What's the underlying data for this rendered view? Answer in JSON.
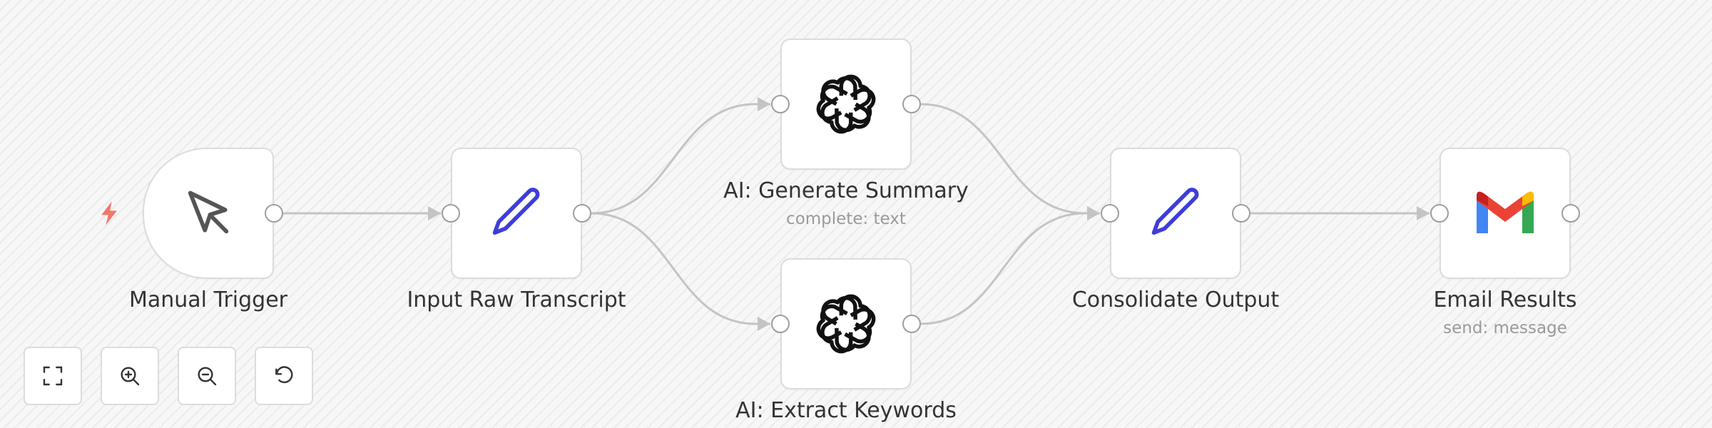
{
  "workflow": {
    "nodes": [
      {
        "id": "manual-trigger",
        "label": "Manual Trigger",
        "subtitle": "",
        "icon": "cursor-icon",
        "is_trigger": true
      },
      {
        "id": "input-raw-transcript",
        "label": "Input Raw Transcript",
        "subtitle": "",
        "icon": "pencil-icon"
      },
      {
        "id": "ai-generate-summary",
        "label": "AI: Generate Summary",
        "subtitle": "complete: text",
        "icon": "openai-icon"
      },
      {
        "id": "ai-extract-keywords",
        "label": "AI: Extract Keywords",
        "subtitle": "",
        "icon": "openai-icon"
      },
      {
        "id": "consolidate-output",
        "label": "Consolidate Output",
        "subtitle": "",
        "icon": "pencil-icon"
      },
      {
        "id": "email-results",
        "label": "Email Results",
        "subtitle": "send: message",
        "icon": "gmail-icon"
      }
    ],
    "connections": [
      [
        "manual-trigger",
        "input-raw-transcript"
      ],
      [
        "input-raw-transcript",
        "ai-generate-summary"
      ],
      [
        "input-raw-transcript",
        "ai-extract-keywords"
      ],
      [
        "ai-generate-summary",
        "consolidate-output"
      ],
      [
        "ai-extract-keywords",
        "consolidate-output"
      ],
      [
        "consolidate-output",
        "email-results"
      ]
    ]
  },
  "controls": [
    {
      "id": "fit-view",
      "icon": "fit-view-icon"
    },
    {
      "id": "zoom-in",
      "icon": "zoom-in-icon"
    },
    {
      "id": "zoom-out",
      "icon": "zoom-out-icon"
    },
    {
      "id": "reset-zoom",
      "icon": "undo-icon"
    }
  ],
  "colors": {
    "pencil": "#3d3ddb",
    "trigger_bolt": "#f0776a",
    "gmail_red": "#ea4335",
    "gmail_blue": "#4285f4",
    "gmail_green": "#34a853",
    "gmail_yellow": "#fbbc04",
    "gmail_darkred": "#c5221f"
  }
}
